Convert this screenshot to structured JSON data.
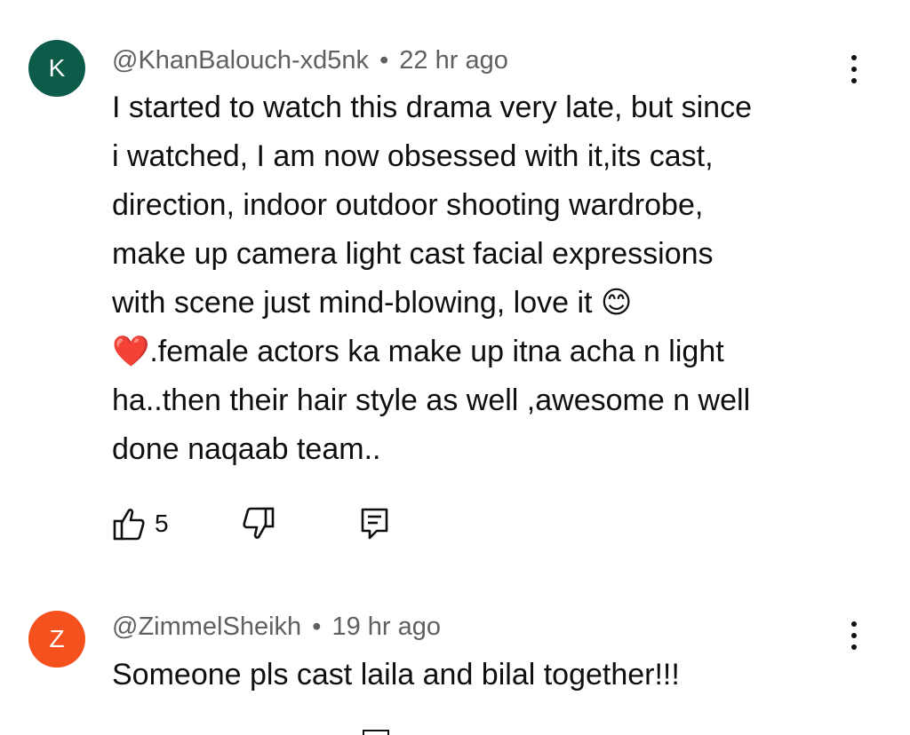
{
  "comments": [
    {
      "avatar_letter": "K",
      "avatar_color": "#0d5c4a",
      "author": "@KhanBalouch-xd5nk",
      "separator": "•",
      "time": "22 hr ago",
      "text": "I started to watch this drama very late, but since\ni watched, I am now obsessed with it,its cast,\ndirection, indoor outdoor shooting wardrobe,\nmake up  camera light cast facial  expressions\nwith scene just mind-blowing, love it 😊\n❤️.female actors ka make up itna acha n light\nha..then their hair style as well ,awesome n well\ndone naqaab team..",
      "like_count": "5"
    },
    {
      "avatar_letter": "Z",
      "avatar_color": "#f4511e",
      "author": "@ZimmelSheikh",
      "separator": "•",
      "time": "19 hr ago",
      "text": "Someone pls cast laila and bilal together!!!"
    }
  ],
  "icons": {
    "like": "thumb-up-icon",
    "dislike": "thumb-down-icon",
    "reply": "reply-comment-icon",
    "more": "more-vert-icon"
  }
}
